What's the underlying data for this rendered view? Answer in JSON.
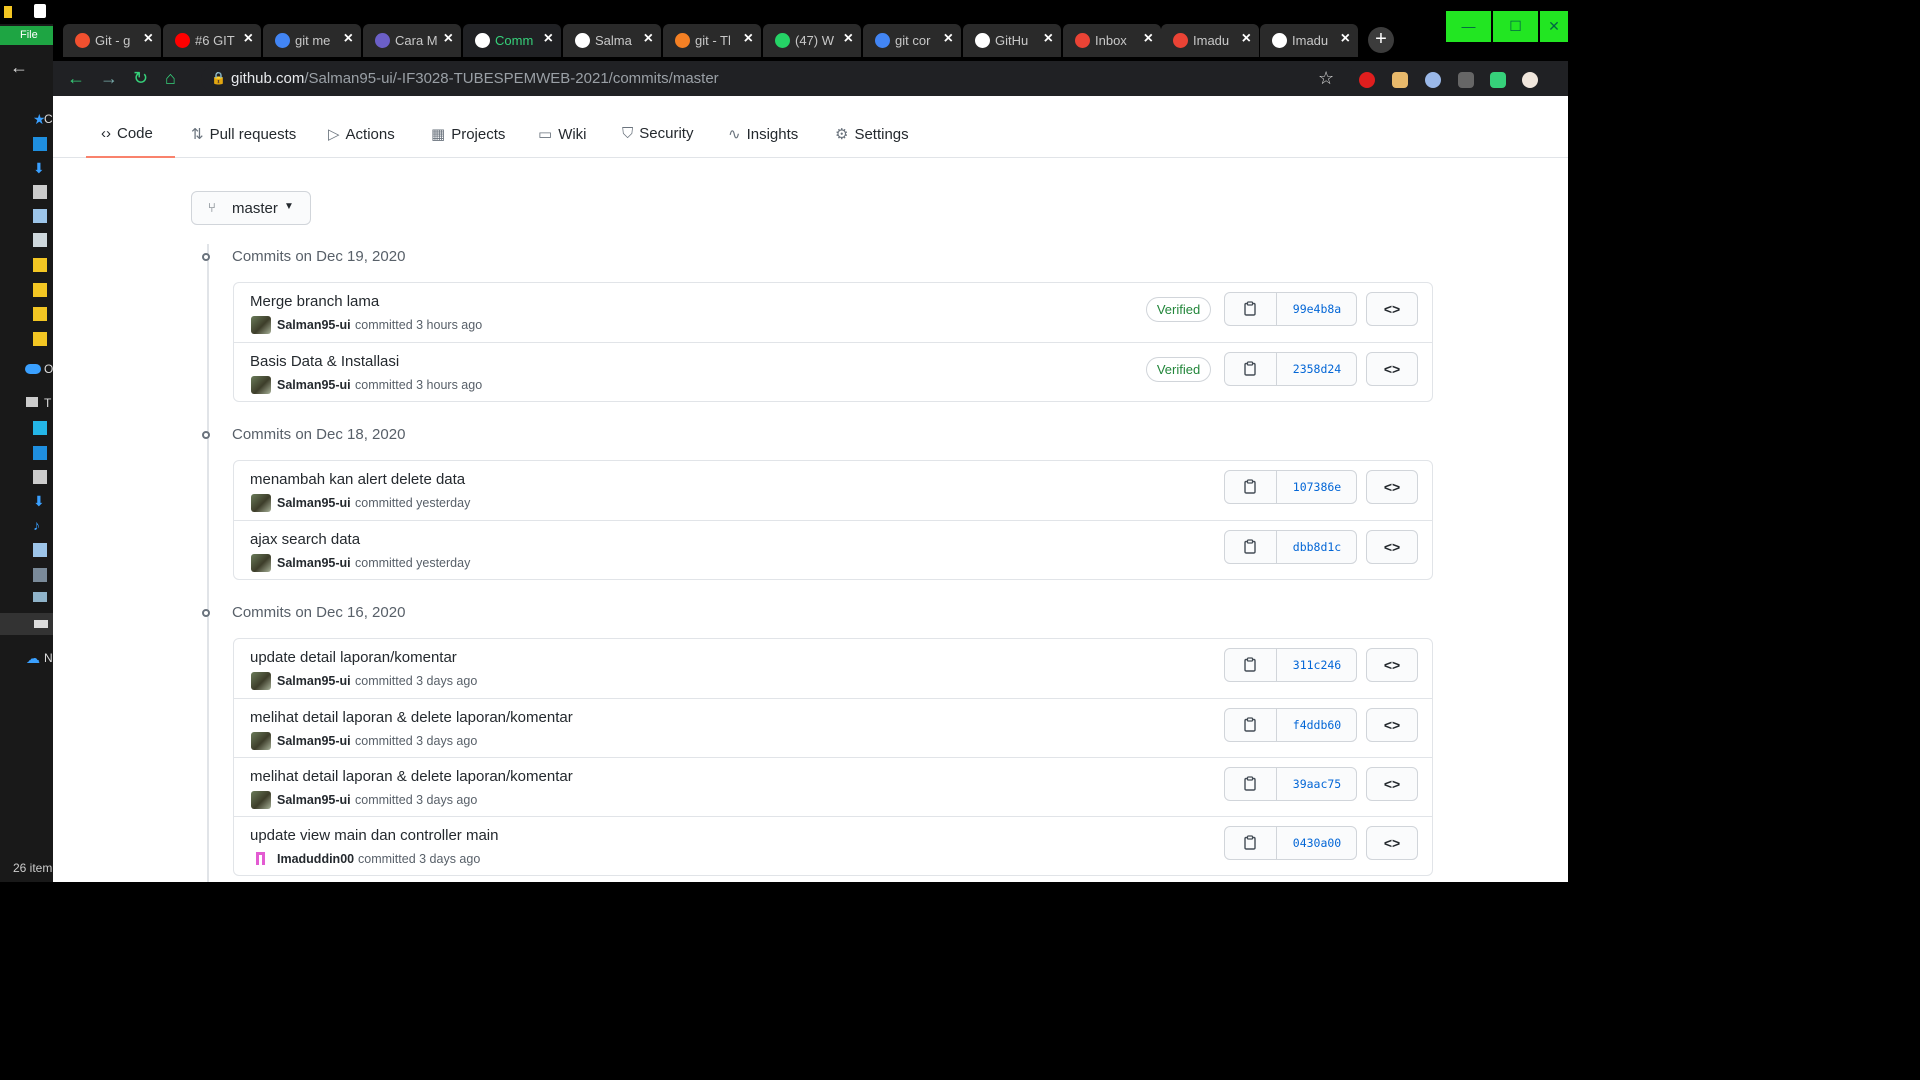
{
  "explorer": {
    "file_tab": "File",
    "side_letters": [
      "C",
      "O",
      "T",
      "N"
    ],
    "status": "26 item"
  },
  "browser": {
    "tabs": [
      {
        "title": "Git - g",
        "icon": "git-icon",
        "color": "#f1502f"
      },
      {
        "title": "#6 GIT",
        "icon": "youtube-icon",
        "color": "#ff0000"
      },
      {
        "title": "git me",
        "icon": "google-icon",
        "color": "#4285f4"
      },
      {
        "title": "Cara M",
        "icon": "gitlab-icon",
        "color": "#6b5fc7"
      },
      {
        "title": "Comm",
        "icon": "github-icon",
        "color": "#ffffff"
      },
      {
        "title": "Salma",
        "icon": "github-icon",
        "color": "#ffffff"
      },
      {
        "title": "git - Tl",
        "icon": "stackoverflow-icon",
        "color": "#f48024"
      },
      {
        "title": "(47) W",
        "icon": "whatsapp-icon",
        "color": "#25d366"
      },
      {
        "title": "git cor",
        "icon": "google-icon",
        "color": "#4285f4"
      },
      {
        "title": "GitHu",
        "icon": "github-icon",
        "color": "#ffffff"
      },
      {
        "title": "Inbox",
        "icon": "gmail-icon",
        "color": "#ea4335"
      },
      {
        "title": "Imadu",
        "icon": "gmail-icon",
        "color": "#ea4335"
      },
      {
        "title": "Imadu",
        "icon": "github-icon",
        "color": "#ffffff"
      }
    ],
    "url_domain": "github.com",
    "url_path": "/Salman95-ui/-IF3028-TUBESPEMWEB-2021/commits/master"
  },
  "repo_nav": {
    "tabs": [
      {
        "label": "Code",
        "icon": "code-icon"
      },
      {
        "label": "Pull requests",
        "icon": "pull-request-icon"
      },
      {
        "label": "Actions",
        "icon": "play-icon"
      },
      {
        "label": "Projects",
        "icon": "project-icon"
      },
      {
        "label": "Wiki",
        "icon": "book-icon"
      },
      {
        "label": "Security",
        "icon": "shield-icon"
      },
      {
        "label": "Insights",
        "icon": "graph-icon"
      },
      {
        "label": "Settings",
        "icon": "gear-icon"
      }
    ]
  },
  "branch": {
    "name": "master"
  },
  "groups": [
    {
      "heading": "Commits on Dec 19, 2020",
      "commits": [
        {
          "message": "Merge branch lama",
          "author": "Salman95-ui",
          "meta": "committed 3 hours ago",
          "verified": "Verified",
          "sha": "99e4b8a"
        },
        {
          "message": "Basis Data & Installasi",
          "author": "Salman95-ui",
          "meta": "committed 3 hours ago",
          "verified": "Verified",
          "sha": "2358d24"
        }
      ]
    },
    {
      "heading": "Commits on Dec 18, 2020",
      "commits": [
        {
          "message": "menambah kan alert delete data",
          "author": "Salman95-ui",
          "meta": "committed yesterday",
          "verified": "",
          "sha": "107386e"
        },
        {
          "message": "ajax search data",
          "author": "Salman95-ui",
          "meta": "committed yesterday",
          "verified": "",
          "sha": "dbb8d1c"
        }
      ]
    },
    {
      "heading": "Commits on Dec 16, 2020",
      "commits": [
        {
          "message": "update detail laporan/komentar",
          "author": "Salman95-ui",
          "meta": "committed 3 days ago",
          "verified": "",
          "sha": "311c246"
        },
        {
          "message": "melihat detail laporan & delete laporan/komentar",
          "author": "Salman95-ui",
          "meta": "committed 3 days ago",
          "verified": "",
          "sha": "f4ddb60"
        },
        {
          "message": "melihat detail laporan & delete laporan/komentar",
          "author": "Salman95-ui",
          "meta": "committed 3 days ago",
          "verified": "",
          "sha": "39aac75"
        },
        {
          "message": "update view main dan controller main",
          "author": "Imaduddin00",
          "meta": "committed 3 days ago",
          "verified": "",
          "sha": "0430a00"
        }
      ]
    }
  ]
}
